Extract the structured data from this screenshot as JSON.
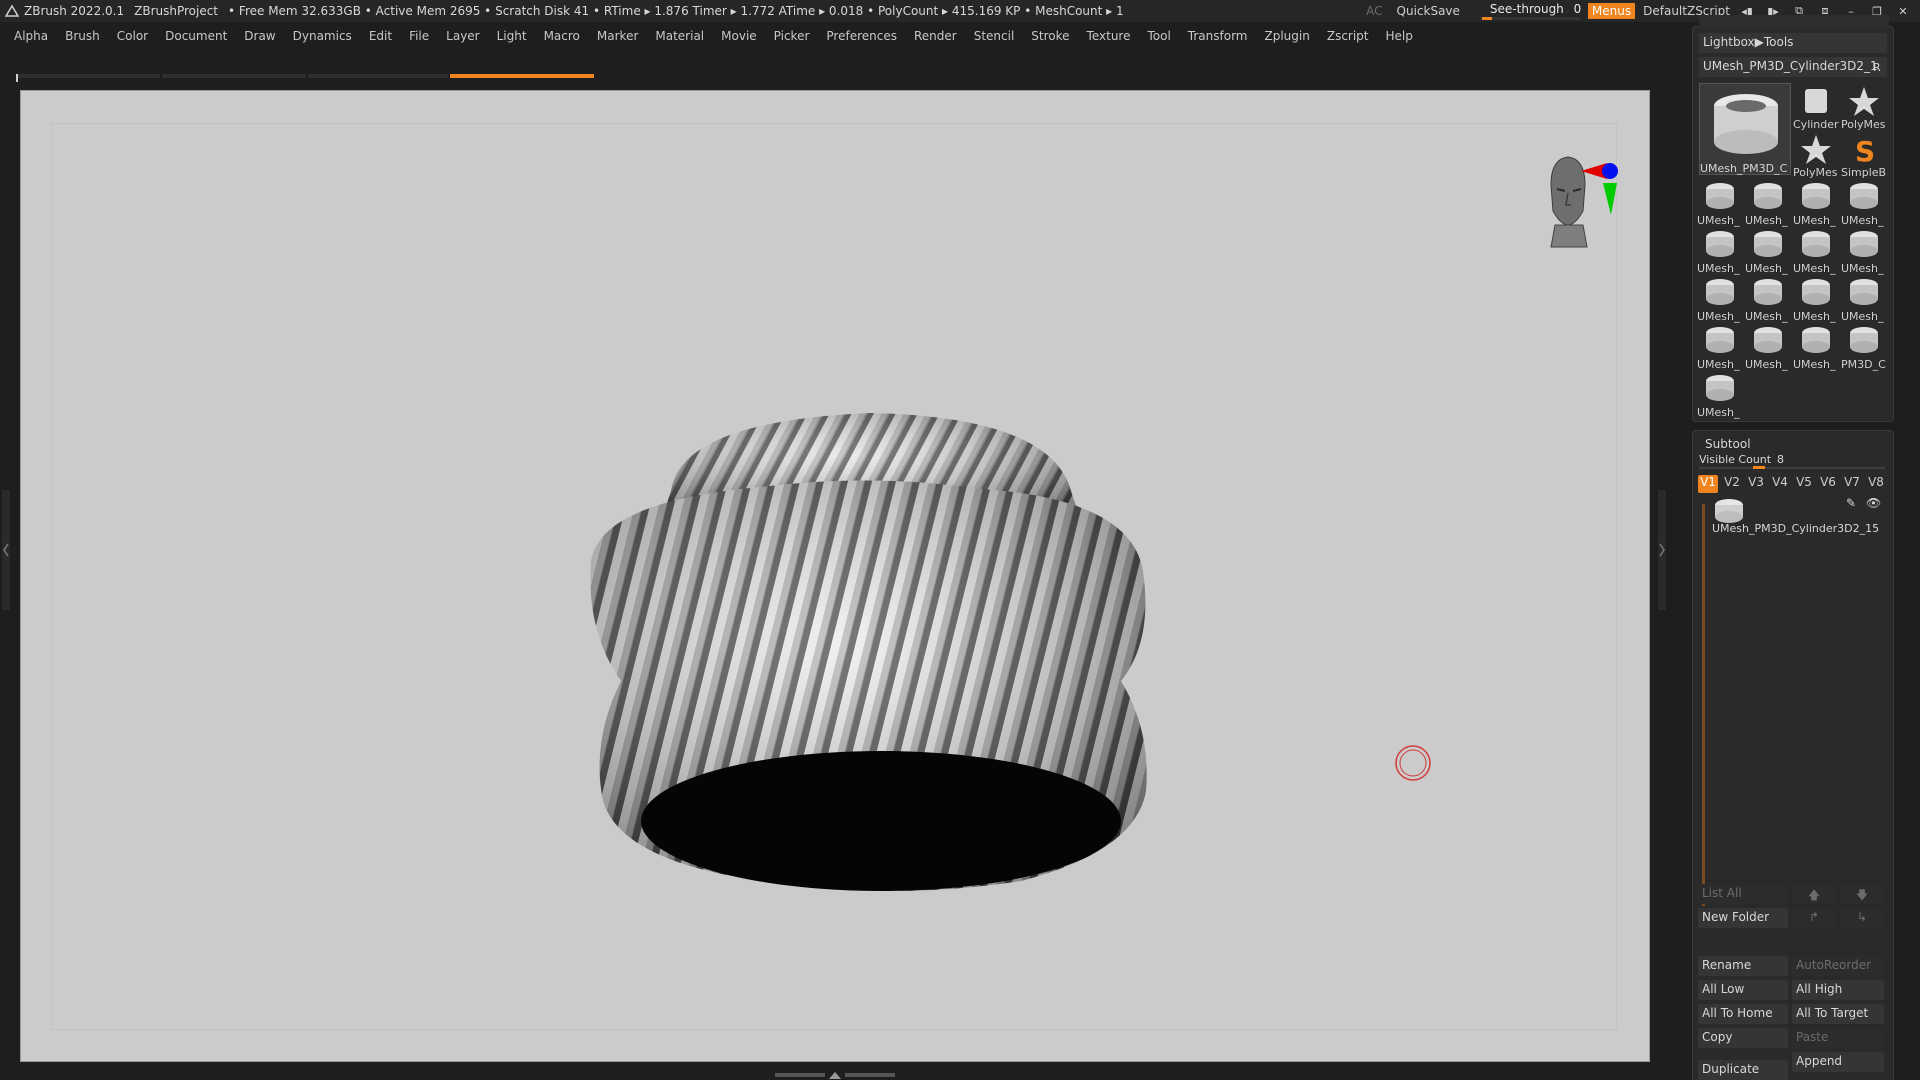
{
  "titlebar": {
    "app": "ZBrush 2022.0.1",
    "project": "ZBrushProject",
    "stats": "• Free Mem 32.633GB • Active Mem 2695 • Scratch Disk 41 •  RTime ▸ 1.876 Timer ▸ 1.772 ATime ▸ 0.018 • PolyCount ▸ 415.169 KP  • MeshCount ▸ 1",
    "ac": "AC",
    "quicksave": "QuickSave",
    "see_through_label": "See-through",
    "see_through_value": "0",
    "see_through_fraction": 0.1,
    "menus": "Menus",
    "zscript": "DefaultZScript"
  },
  "menubar": [
    "Alpha",
    "Brush",
    "Color",
    "Document",
    "Draw",
    "Dynamics",
    "Edit",
    "File",
    "Layer",
    "Light",
    "Macro",
    "Marker",
    "Material",
    "Movie",
    "Picker",
    "Preferences",
    "Render",
    "Stencil",
    "Stroke",
    "Texture",
    "Tool",
    "Transform",
    "Zplugin",
    "Zscript",
    "Help"
  ],
  "tool_panel": {
    "lightbox_tools": "Lightbox▶Tools",
    "current_tool": "UMesh_PM3D_Cylinder3D2_1",
    "r": "R",
    "big_thumb_label": "UMesh_PM3D_C",
    "small_thumbs": [
      "Cylinder",
      "PolyMes",
      "PolyMes",
      "SimpleB"
    ],
    "grid": [
      "UMesh_",
      "UMesh_",
      "UMesh_",
      "UMesh_",
      "UMesh_",
      "UMesh_",
      "UMesh_",
      "UMesh_",
      "UMesh_",
      "UMesh_",
      "UMesh_",
      "UMesh_",
      "UMesh_",
      "UMesh_",
      "UMesh_",
      "PM3D_C",
      "UMesh_"
    ]
  },
  "subtool": {
    "title": "Subtool",
    "visible_count_label": "Visible Count",
    "visible_count": "8",
    "versions": [
      "V1",
      "V2",
      "V3",
      "V4",
      "V5",
      "V6",
      "V7",
      "V8"
    ],
    "item_name": "UMesh_PM3D_Cylinder3D2_15",
    "list_all": "List All",
    "new_folder": "New Folder",
    "rename": "Rename",
    "auto_reorder": "AutoReorder",
    "all_low": "All Low",
    "all_high": "All High",
    "all_to_home": "All To Home",
    "all_to_target": "All To Target",
    "copy": "Copy",
    "paste": "Paste",
    "append": "Append",
    "duplicate": "Duplicate"
  },
  "colors": {
    "accent": "#f0841e",
    "viewport_bg": "#cbcbcb",
    "ui_bg": "#1e1e1e"
  }
}
